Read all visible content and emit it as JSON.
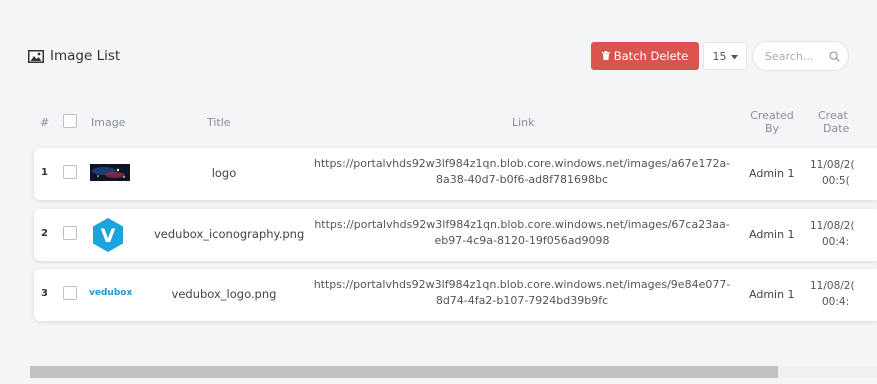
{
  "header": {
    "title": "Image List",
    "icon": "image-icon",
    "batch_delete_label": "Batch Delete",
    "batch_delete_icon": "trash-icon",
    "page_size": "15",
    "search_placeholder": "Search..."
  },
  "table": {
    "columns": {
      "index": "#",
      "image": "Image",
      "title": "Title",
      "link": "Link",
      "created_by_1": "Created",
      "created_by_2": "By",
      "created_date_1": "Creat",
      "created_date_2": "Date"
    },
    "rows": [
      {
        "index": "1",
        "thumb": "space-photo-thumbnail",
        "title": "logo",
        "link_1": "https://portalvhds92w3lf984z1qn.blob.core.windows.net/images/a67e172a-",
        "link_2": "8a38-40d7-b0f6-ad8f781698bc",
        "created_by": "Admin 1",
        "date_1": "11/08/2(",
        "date_2": "00:5("
      },
      {
        "index": "2",
        "thumb": "vedubox-v-icon",
        "thumb_text": "V",
        "title": "vedubox_iconography.png",
        "link_1": "https://portalvhds92w3lf984z1qn.blob.core.windows.net/images/67ca23aa-",
        "link_2": "eb97-4c9a-8120-19f056ad9098",
        "created_by": "Admin 1",
        "date_1": "11/08/2(",
        "date_2": "00:4:"
      },
      {
        "index": "3",
        "thumb": "vedubox-wordmark",
        "thumb_text": "vedubox",
        "title": "vedubox_logo.png",
        "link_1": "https://portalvhds92w3lf984z1qn.blob.core.windows.net/images/9e84e077-",
        "link_2": "8d74-4fa2-b107-7924bd39b9fc",
        "created_by": "Admin 1",
        "date_1": "11/08/2(",
        "date_2": "00:4:"
      }
    ]
  },
  "colors": {
    "danger": "#d9534f",
    "brand": "#1a9ad6"
  }
}
